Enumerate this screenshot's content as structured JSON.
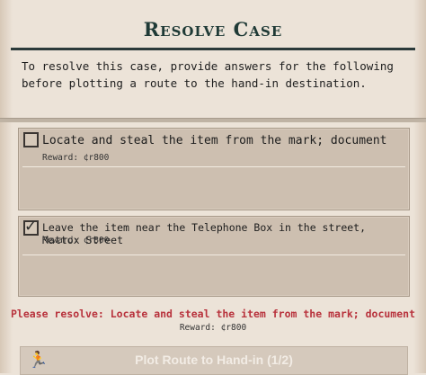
{
  "title": "Resolve Case",
  "intro": "To resolve this case, provide answers for the following before plotting a route to the hand-in destination.",
  "tasks": [
    {
      "text": "Locate and steal the item from the mark; document",
      "reward": "Reward: ¢r800",
      "checked": false
    },
    {
      "text": "Leave the item near the Telephone Box in the street, Mattox Street",
      "reward": "Reward: ¢r800",
      "checked": true
    }
  ],
  "warning": {
    "text": "Please resolve: Locate and steal the item from the mark; document",
    "reward": "Reward: ¢r800"
  },
  "plot_button": {
    "label": "Plot Route to Hand-in (1/2)",
    "icon": "running-person-icon",
    "enabled": false
  },
  "colors": {
    "title": "#1f3a36",
    "warning": "#b8323c",
    "panel": "#cdbfb0",
    "background": "#ece3d8"
  }
}
